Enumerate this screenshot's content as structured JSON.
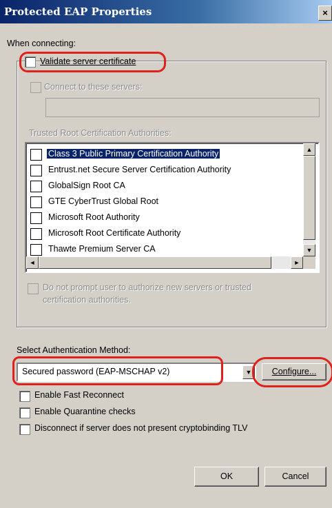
{
  "window": {
    "title": "Protected EAP Properties",
    "close_label": "×"
  },
  "when_connecting": {
    "label": "When connecting:",
    "validate_cert": {
      "label": "Validate server certificate",
      "checked": false
    },
    "connect_servers": {
      "label": "Connect to these servers:",
      "checked": false,
      "value": ""
    },
    "trusted_root_label": "Trusted Root Certification Authorities:",
    "trusted_root_items": [
      {
        "label": "Class 3 Public Primary Certification Authority",
        "checked": false,
        "selected": true
      },
      {
        "label": "Entrust.net Secure Server Certification Authority",
        "checked": false
      },
      {
        "label": "GlobalSign Root CA",
        "checked": false
      },
      {
        "label": "GTE CyberTrust Global Root",
        "checked": false
      },
      {
        "label": "Microsoft Root Authority",
        "checked": false
      },
      {
        "label": "Microsoft Root Certificate Authority",
        "checked": false
      },
      {
        "label": "Thawte Premium Server CA",
        "checked": false
      }
    ],
    "do_not_prompt": {
      "line1": "Do not prompt user to authorize new servers or trusted",
      "line2": "certification authorities.",
      "checked": false
    }
  },
  "auth": {
    "label": "Select Authentication Method:",
    "selected": "Secured password (EAP-MSCHAP v2)",
    "configure_label": "Configure..."
  },
  "options": [
    {
      "label": "Enable Fast Reconnect",
      "checked": false
    },
    {
      "label": "Enable Quarantine checks",
      "checked": false
    },
    {
      "label": "Disconnect if server does not present cryptobinding TLV",
      "checked": false
    }
  ],
  "buttons": {
    "ok": "OK",
    "cancel": "Cancel"
  },
  "icons": {
    "scroll_up": "▲",
    "scroll_down": "▼",
    "scroll_left": "◄",
    "scroll_right": "►",
    "dropdown": "▼"
  },
  "colors": {
    "highlight": "#0a246a",
    "annotation_red": "#e0201a",
    "dialog_bg": "#d4d0c8"
  }
}
